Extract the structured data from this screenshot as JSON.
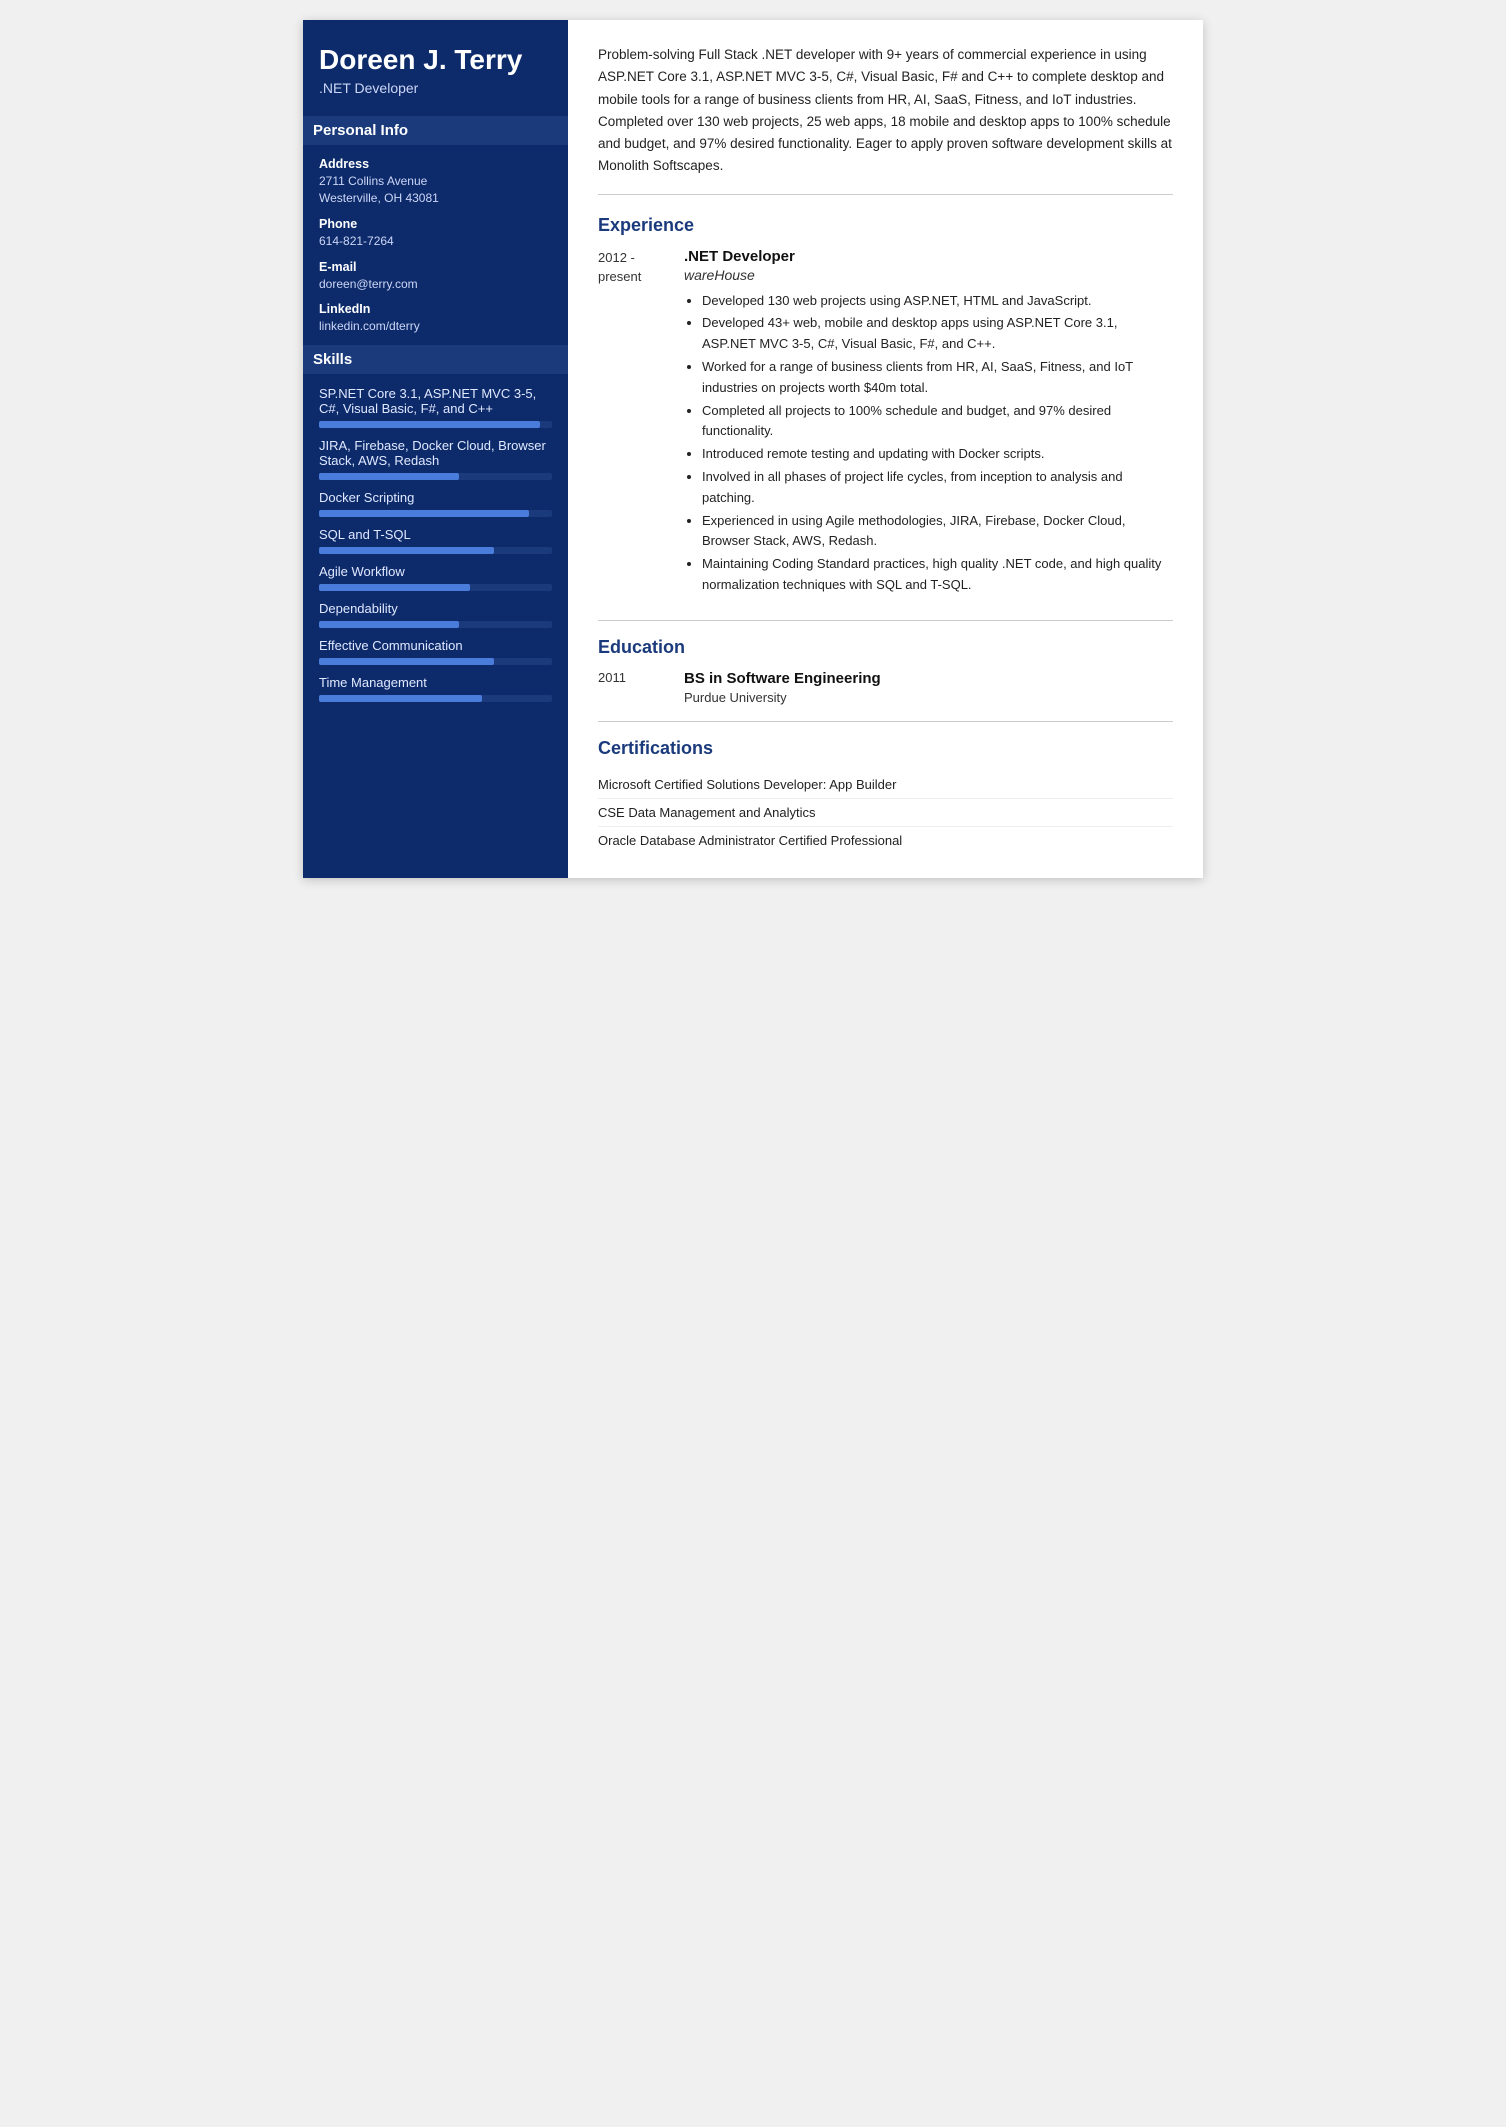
{
  "sidebar": {
    "name": "Doreen J. Terry",
    "title": ".NET Developer",
    "sections": {
      "personal_info": {
        "label": "Personal Info",
        "fields": [
          {
            "label": "Address",
            "value": "2711 Collins Avenue\nWesterville, OH 43081"
          },
          {
            "label": "Phone",
            "value": "614-821-7264"
          },
          {
            "label": "E-mail",
            "value": "doreen@terry.com"
          },
          {
            "label": "LinkedIn",
            "value": "linkedin.com/dterry"
          }
        ]
      },
      "skills": {
        "label": "Skills",
        "items": [
          {
            "name": "SP.NET Core 3.1, ASP.NET MVC 3-5, C#, Visual Basic, F#, and C++",
            "fill": 95
          },
          {
            "name": "JIRA, Firebase, Docker Cloud, Browser Stack, AWS, Redash",
            "fill": 60
          },
          {
            "name": "Docker Scripting",
            "fill": 90
          },
          {
            "name": "SQL and T-SQL",
            "fill": 75
          },
          {
            "name": "Agile Workflow",
            "fill": 65
          },
          {
            "name": "Dependability",
            "fill": 60
          },
          {
            "name": "Effective Communication",
            "fill": 75
          },
          {
            "name": "Time Management",
            "fill": 70
          }
        ]
      }
    }
  },
  "main": {
    "summary": "Problem-solving Full Stack .NET developer with 9+ years of commercial experience in using ASP.NET Core 3.1, ASP.NET MVC 3-5, C#, Visual Basic, F# and C++ to complete desktop and mobile tools for a range of business clients from HR, AI, SaaS, Fitness, and IoT industries. Completed over 130 web projects, 25 web apps, 18 mobile and desktop apps to 100% schedule and budget, and 97% desired functionality. Eager to apply proven software development skills at Monolith Softscapes.",
    "experience": {
      "label": "Experience",
      "jobs": [
        {
          "date": "2012 -\npresent",
          "title": ".NET Developer",
          "company": "wareHouse",
          "bullets": [
            "Developed 130 web projects using ASP.NET, HTML and JavaScript.",
            "Developed 43+ web, mobile and desktop apps using ASP.NET Core 3.1, ASP.NET MVC 3-5, C#, Visual Basic, F#, and C++.",
            "Worked for a range of business clients from HR, AI, SaaS, Fitness, and IoT industries on projects worth $40m total.",
            "Completed all projects to 100% schedule and budget, and 97% desired functionality.",
            "Introduced remote testing and updating with Docker scripts.",
            "Involved in all phases of project life cycles, from inception to analysis and patching.",
            "Experienced in using Agile methodologies, JIRA, Firebase, Docker Cloud, Browser Stack, AWS, Redash.",
            "Maintaining Coding Standard practices, high quality .NET code, and high quality normalization techniques with SQL and T-SQL."
          ]
        }
      ]
    },
    "education": {
      "label": "Education",
      "items": [
        {
          "date": "2011",
          "degree": "BS in Software Engineering",
          "school": "Purdue University"
        }
      ]
    },
    "certifications": {
      "label": "Certifications",
      "items": [
        "Microsoft Certified Solutions Developer: App Builder",
        "CSE Data Management and Analytics",
        "Oracle Database Administrator Certified Professional"
      ]
    }
  }
}
